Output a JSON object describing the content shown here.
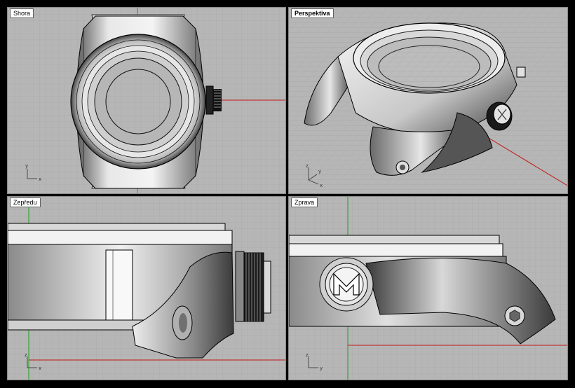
{
  "viewports": {
    "top": {
      "label": "Shora"
    },
    "perspective": {
      "label": "Perspektiva"
    },
    "front": {
      "label": "Zepředu"
    },
    "right": {
      "label": "Zprava"
    }
  },
  "axes": {
    "top": {
      "a": "y",
      "b": "x"
    },
    "perspective": {
      "a": "z",
      "b": "y",
      "c": "x"
    },
    "front": {
      "a": "z",
      "b": "x"
    },
    "right": {
      "a": "z",
      "b": "y"
    }
  },
  "colors": {
    "background": "#b6b6b6",
    "grid": "#a6a6a6",
    "grid_major": "#8e8e8e",
    "x_axis": "#c21616",
    "y_axis": "#1aa01a",
    "frame": "#000000"
  },
  "icons": [
    "crown-icon",
    "logo-m-icon",
    "screw-icon"
  ]
}
